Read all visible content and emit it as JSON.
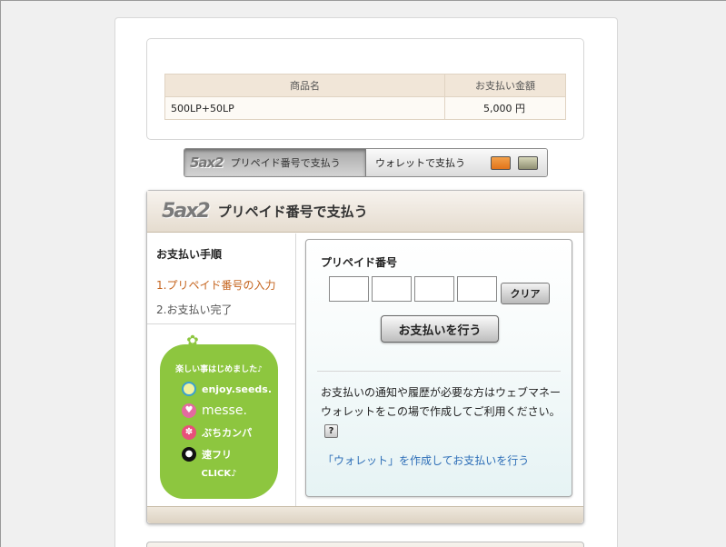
{
  "product": {
    "headers": [
      "商品名",
      "お支払い金額"
    ],
    "rows": [
      {
        "name": "500LP+50LP",
        "price": "5,000 円"
      }
    ]
  },
  "tabs": {
    "brand": "5ax2",
    "prepaid_label": "プリペイド番号で支払う",
    "wallet_label": "ウォレットで支払う"
  },
  "panel": {
    "brand": "5ax2",
    "title": "プリペイド番号で支払う"
  },
  "steps": {
    "title": "お支払い手順",
    "items": [
      "1.プリペイド番号の入力",
      "2.お支払い完了"
    ]
  },
  "seeds": {
    "tagline": "楽しい事はじめました♪",
    "items": [
      "enjoy.seeds.",
      "messe.",
      "ぷちカンパ",
      "速フリ"
    ],
    "click": "CLICK♪"
  },
  "form": {
    "label": "プリペイド番号",
    "clear_label": "クリア",
    "pay_label": "お支払いを行う",
    "note": "お支払いの通知や履歴が必要な方はウェブマネー ウォレットをこの場で作成してご利用ください。",
    "help": "?",
    "wallet_link": "「ウォレット」を作成してお支払いを行う"
  },
  "icons": {
    "tab_card_1": "orange-card-icon",
    "tab_card_2": "gray-card-icon"
  },
  "colors": {
    "accent_step": "#c5641e",
    "link": "#2f6fb8",
    "seeds_green": "#8dc63f"
  }
}
